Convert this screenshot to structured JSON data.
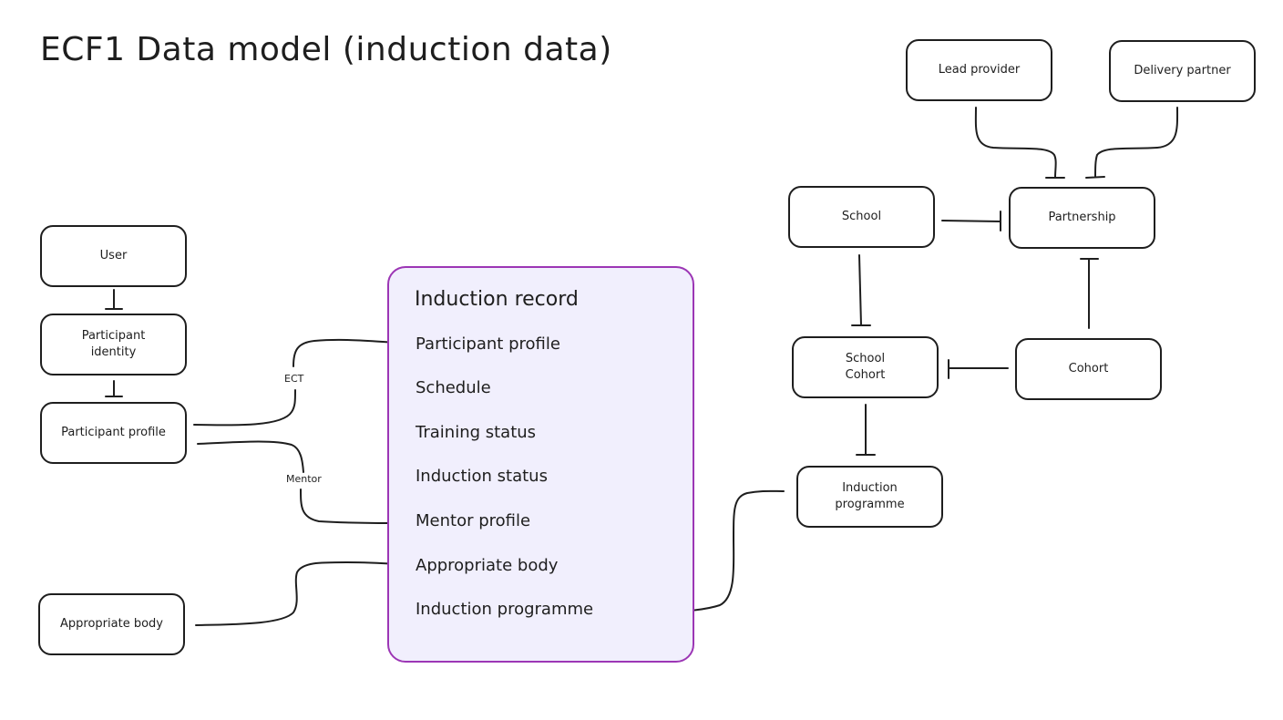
{
  "title": "ECF1 Data model (induction data)",
  "colors": {
    "stroke": "#1e1e1e",
    "record_border": "#9c36b5",
    "record_fill": "#f1effd",
    "background": "#ffffff"
  },
  "nodes": {
    "user": "User",
    "participant_identity": "Participant\nidentity",
    "participant_profile": "Participant profile",
    "appropriate_body": "Appropriate body",
    "lead_provider": "Lead provider",
    "delivery_partner": "Delivery partner",
    "school": "School",
    "partnership": "Partnership",
    "school_cohort": "School\nCohort",
    "cohort": "Cohort",
    "induction_programme": "Induction\nprogramme"
  },
  "induction_record": {
    "title": "Induction record",
    "fields": [
      "Participant profile",
      "Schedule",
      "Training status",
      "Induction status",
      "Mentor profile",
      "Appropriate body",
      "Induction programme"
    ]
  },
  "edge_labels": {
    "ect": "ECT",
    "mentor": "Mentor"
  },
  "relationships": [
    {
      "from": "User",
      "to": "Participant identity"
    },
    {
      "from": "Participant identity",
      "to": "Participant profile"
    },
    {
      "from": "Participant profile",
      "to": "Induction record.Participant profile",
      "label": "ECT"
    },
    {
      "from": "Participant profile",
      "to": "Induction record.Mentor profile",
      "label": "Mentor"
    },
    {
      "from": "Appropriate body",
      "to": "Induction record.Appropriate body"
    },
    {
      "from": "Induction programme",
      "to": "Induction record.Induction programme"
    },
    {
      "from": "Lead provider",
      "to": "Partnership"
    },
    {
      "from": "Delivery partner",
      "to": "Partnership"
    },
    {
      "from": "School",
      "to": "Partnership"
    },
    {
      "from": "Cohort",
      "to": "Partnership"
    },
    {
      "from": "School",
      "to": "School Cohort"
    },
    {
      "from": "Cohort",
      "to": "School Cohort"
    },
    {
      "from": "School Cohort",
      "to": "Induction programme"
    }
  ]
}
